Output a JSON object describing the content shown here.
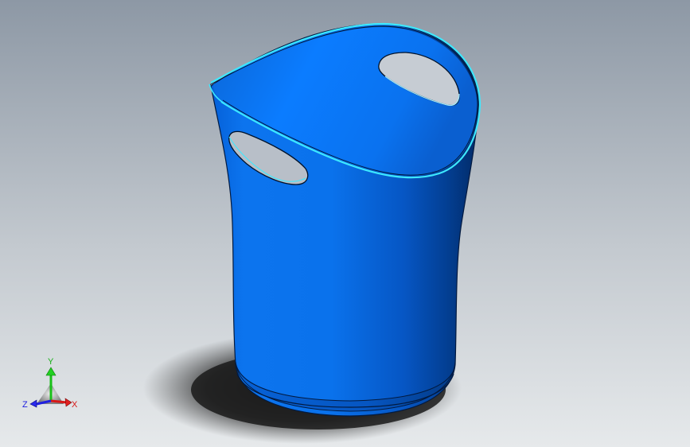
{
  "viewport": {
    "background_top": "#8e99a6",
    "background_bottom": "#e4e7ea"
  },
  "model": {
    "body_color": "#0a6fe6",
    "rim_highlight_color": "#38e6ff",
    "shadow_color": "#1f1f1f"
  },
  "triad": {
    "y_label": "Y",
    "x_label": "X",
    "z_label": "Z",
    "x_color": "#d81818",
    "y_color": "#18c018",
    "z_color": "#2020e0"
  }
}
